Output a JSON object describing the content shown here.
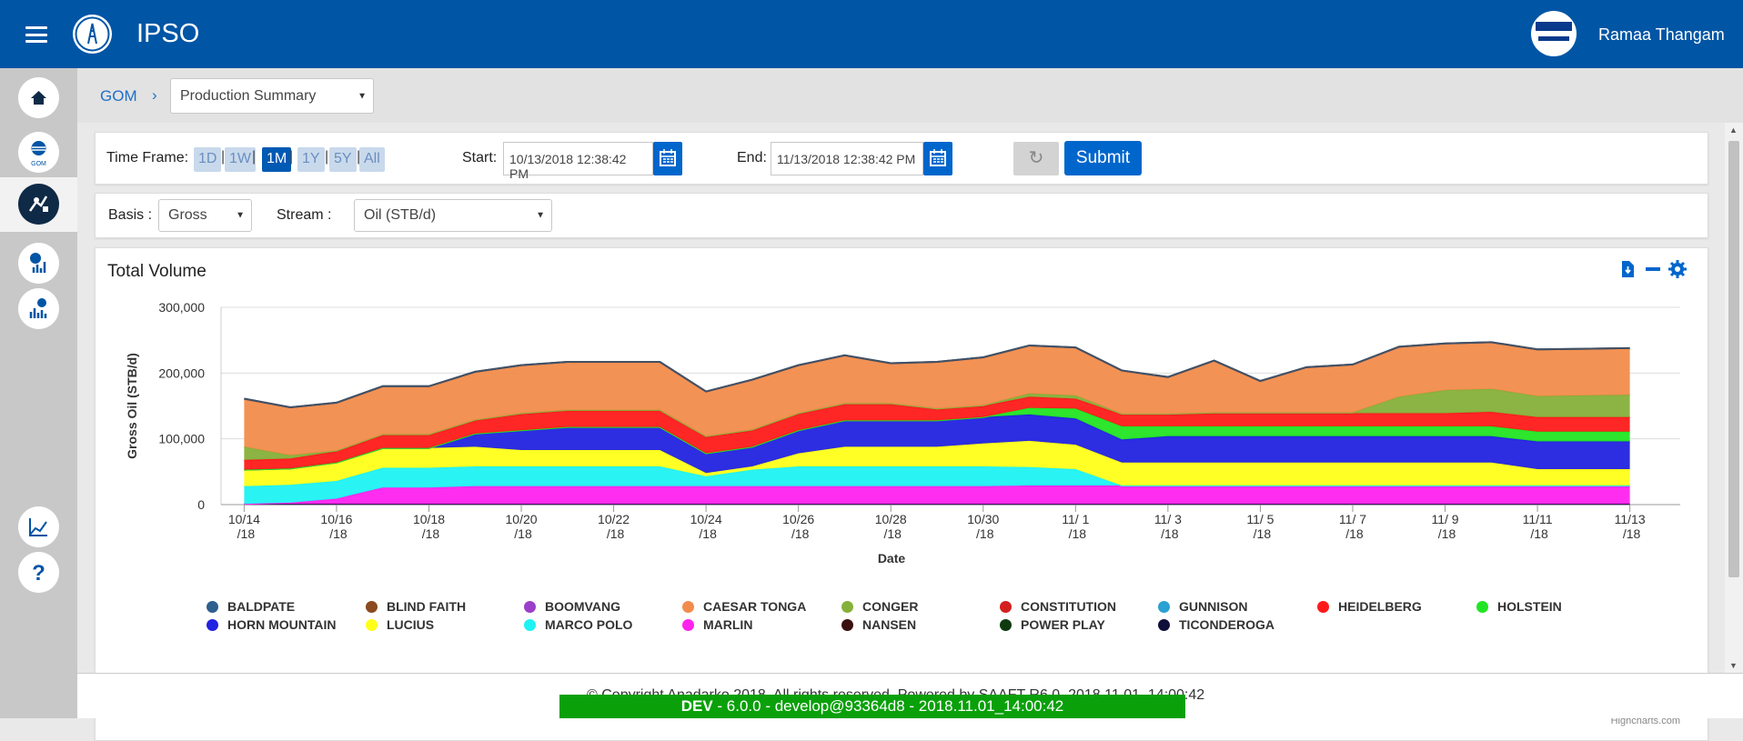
{
  "header": {
    "app_title": "IPSO",
    "user_name": "Ramaa Thangam"
  },
  "sidebar": {
    "items": [
      {
        "name": "home-icon"
      },
      {
        "name": "gom-icon",
        "label": "GOM"
      },
      {
        "name": "production-icon"
      },
      {
        "name": "analytics-icon"
      },
      {
        "name": "reports-icon"
      },
      {
        "name": "trend-icon"
      },
      {
        "name": "help-icon"
      }
    ]
  },
  "breadcrumb": {
    "root": "GOM",
    "separator": "›",
    "page_select": "Production Summary"
  },
  "filters": {
    "timeframe_label": "Time Frame:",
    "timeframes": [
      "1D",
      "1W",
      "1M",
      "1Y",
      "5Y",
      "All"
    ],
    "timeframe_active": "1M",
    "start_label": "Start:",
    "start_value": "10/13/2018 12:38:42 PM",
    "end_label": "End:",
    "end_value": "11/13/2018 12:38:42 PM",
    "submit_label": "Submit"
  },
  "options": {
    "basis_label": "Basis :",
    "basis_value": "Gross",
    "stream_label": "Stream :",
    "stream_value": "Oil (STB/d)"
  },
  "chart_panel": {
    "title": "Total Volume",
    "credits": "Highcharts.com"
  },
  "chart_data": {
    "type": "area",
    "stacked": true,
    "xlabel": "Date",
    "ylabel": "Gross Oil (STB/d)",
    "ylim": [
      0,
      300000
    ],
    "yticks": [
      "0",
      "100,000",
      "200,000",
      "300,000"
    ],
    "xticks": [
      [
        "10/14",
        "/18"
      ],
      [
        "10/16",
        "/18"
      ],
      [
        "10/18",
        "/18"
      ],
      [
        "10/20",
        "/18"
      ],
      [
        "10/22",
        "/18"
      ],
      [
        "10/24",
        "/18"
      ],
      [
        "10/26",
        "/18"
      ],
      [
        "10/28",
        "/18"
      ],
      [
        "10/30",
        "/18"
      ],
      [
        "11/ 1",
        "/18"
      ],
      [
        "11/ 3",
        "/18"
      ],
      [
        "11/ 5",
        "/18"
      ],
      [
        "11/ 7",
        "/18"
      ],
      [
        "11/ 9",
        "/18"
      ],
      [
        "11/11",
        "/18"
      ],
      [
        "11/13",
        "/18"
      ]
    ],
    "x": [
      "2018-10-14",
      "2018-10-15",
      "2018-10-16",
      "2018-10-17",
      "2018-10-18",
      "2018-10-19",
      "2018-10-20",
      "2018-10-21",
      "2018-10-22",
      "2018-10-23",
      "2018-10-24",
      "2018-10-25",
      "2018-10-26",
      "2018-10-27",
      "2018-10-28",
      "2018-10-29",
      "2018-10-30",
      "2018-10-31",
      "2018-11-01",
      "2018-11-02",
      "2018-11-03",
      "2018-11-04",
      "2018-11-05",
      "2018-11-06",
      "2018-11-07",
      "2018-11-08",
      "2018-11-09",
      "2018-11-10",
      "2018-11-11",
      "2018-11-12",
      "2018-11-13"
    ],
    "grid": true,
    "legend_position": "bottom",
    "series": [
      {
        "name": "BALDPATE",
        "color": "#2f5f8f",
        "values": [
          1000,
          1000,
          1000,
          1000,
          1000,
          1000,
          1000,
          1000,
          1000,
          1000,
          1000,
          1000,
          1000,
          1000,
          1000,
          1000,
          1000,
          1000,
          1000,
          1000,
          1000,
          1000,
          1000,
          1000,
          1000,
          1000,
          1000,
          1000,
          1000,
          1000,
          1000
        ]
      },
      {
        "name": "BLIND FAITH",
        "color": "#8b4a1f",
        "values": [
          0,
          0,
          0,
          0,
          0,
          0,
          0,
          0,
          0,
          0,
          0,
          0,
          0,
          0,
          0,
          0,
          0,
          0,
          0,
          0,
          0,
          0,
          0,
          0,
          0,
          0,
          0,
          0,
          0,
          0,
          0
        ]
      },
      {
        "name": "BOOMVANG",
        "color": "#9a3fc9",
        "values": [
          0,
          0,
          0,
          0,
          0,
          0,
          0,
          0,
          0,
          0,
          0,
          0,
          0,
          0,
          0,
          0,
          0,
          0,
          0,
          0,
          0,
          0,
          0,
          0,
          0,
          0,
          0,
          0,
          0,
          0,
          0
        ]
      },
      {
        "name": "CAESAR TONGA",
        "color": "#f28c4c",
        "values": [
          72000,
          72000,
          72000,
          72000,
          72000,
          72000,
          72000,
          72000,
          72000,
          72000,
          67000,
          75000,
          72000,
          72000,
          60000,
          70000,
          72000,
          72000,
          72000,
          65000,
          55000,
          78000,
          47000,
          68000,
          72000,
          75000,
          70000,
          70000,
          70000,
          70000,
          70000
        ]
      },
      {
        "name": "CONGER",
        "color": "#86b03a",
        "values": [
          20000,
          5000,
          1000,
          1000,
          1000,
          1000,
          1000,
          1000,
          1000,
          1000,
          1000,
          1000,
          1000,
          1000,
          1000,
          1000,
          1000,
          5000,
          5000,
          1000,
          1000,
          1000,
          1000,
          1000,
          1000,
          25000,
          35000,
          35000,
          32000,
          33000,
          34000
        ]
      },
      {
        "name": "CONSTITUTION",
        "color": "#d41f1f",
        "values": [
          0,
          0,
          0,
          0,
          0,
          0,
          0,
          0,
          0,
          0,
          0,
          0,
          0,
          0,
          0,
          0,
          0,
          0,
          0,
          0,
          0,
          0,
          0,
          0,
          0,
          0,
          0,
          0,
          0,
          0,
          0
        ]
      },
      {
        "name": "GUNNISON",
        "color": "#2aa1d3",
        "values": [
          0,
          0,
          0,
          0,
          0,
          0,
          0,
          0,
          0,
          0,
          0,
          0,
          0,
          0,
          0,
          0,
          0,
          0,
          0,
          0,
          0,
          0,
          0,
          0,
          0,
          0,
          0,
          0,
          0,
          0,
          0
        ]
      },
      {
        "name": "HEIDELBERG",
        "color": "#ff1a1a",
        "values": [
          15000,
          15000,
          17000,
          20000,
          20000,
          20000,
          25000,
          25000,
          25000,
          25000,
          25000,
          25000,
          25000,
          25000,
          25000,
          17000,
          17000,
          17000,
          15000,
          18000,
          18000,
          20000,
          20000,
          20000,
          20000,
          20000,
          20000,
          22000,
          22000,
          22000,
          22000
        ]
      },
      {
        "name": "HOLSTEIN",
        "color": "#22e522",
        "values": [
          0,
          0,
          0,
          0,
          0,
          0,
          0,
          0,
          0,
          0,
          0,
          0,
          0,
          0,
          0,
          0,
          0,
          10000,
          15000,
          20000,
          15000,
          15000,
          15000,
          15000,
          15000,
          15000,
          15000,
          15000,
          15000,
          15000,
          15000
        ]
      },
      {
        "name": "HORN MOUNTAIN",
        "color": "#2222e0",
        "values": [
          0,
          0,
          0,
          0,
          0,
          20000,
          30000,
          35000,
          35000,
          35000,
          30000,
          30000,
          35000,
          40000,
          40000,
          40000,
          40000,
          40000,
          40000,
          35000,
          40000,
          40000,
          40000,
          40000,
          40000,
          40000,
          40000,
          40000,
          42000,
          42000,
          42000
        ]
      },
      {
        "name": "LUCIUS",
        "color": "#ffff1a",
        "values": [
          25000,
          25000,
          28000,
          30000,
          30000,
          30000,
          25000,
          25000,
          25000,
          25000,
          5000,
          5000,
          20000,
          30000,
          30000,
          30000,
          35000,
          40000,
          37000,
          35000,
          35000,
          35000,
          35000,
          35000,
          35000,
          35000,
          35000,
          35000,
          25000,
          25000,
          25000
        ]
      },
      {
        "name": "MARCO POLO",
        "color": "#1ff2f2",
        "values": [
          27000,
          27000,
          27000,
          30000,
          30000,
          30000,
          30000,
          30000,
          30000,
          30000,
          15000,
          25000,
          30000,
          30000,
          30000,
          30000,
          30000,
          28000,
          25000,
          0,
          0,
          0,
          0,
          0,
          0,
          0,
          0,
          0,
          0,
          0,
          0
        ]
      },
      {
        "name": "MARLIN",
        "color": "#ff22ee",
        "values": [
          0,
          2000,
          8000,
          25000,
          25000,
          27000,
          27000,
          27000,
          27000,
          27000,
          27000,
          27000,
          27000,
          27000,
          27000,
          27000,
          27000,
          28000,
          28000,
          28000,
          28000,
          28000,
          28000,
          28000,
          28000,
          28000,
          28000,
          28000,
          28000,
          28000,
          28000
        ]
      },
      {
        "name": "NANSEN",
        "color": "#3a0f0f",
        "values": [
          0,
          0,
          0,
          0,
          0,
          0,
          0,
          0,
          0,
          0,
          0,
          0,
          0,
          0,
          0,
          0,
          0,
          0,
          0,
          0,
          0,
          0,
          0,
          0,
          0,
          0,
          0,
          0,
          0,
          0,
          0
        ]
      },
      {
        "name": "POWER PLAY",
        "color": "#0f3a0f",
        "values": [
          0,
          0,
          0,
          0,
          0,
          0,
          0,
          0,
          0,
          0,
          0,
          0,
          0,
          0,
          0,
          0,
          0,
          0,
          0,
          0,
          0,
          0,
          0,
          0,
          0,
          0,
          0,
          0,
          0,
          0,
          0
        ]
      },
      {
        "name": "TICONDEROGA",
        "color": "#0f0f3a",
        "values": [
          1000,
          1000,
          1000,
          1000,
          1000,
          1000,
          1000,
          1000,
          1000,
          1000,
          1000,
          1000,
          1000,
          1000,
          1000,
          1000,
          1000,
          1000,
          1000,
          1000,
          1000,
          1000,
          1000,
          1000,
          1000,
          1000,
          1000,
          1000,
          1000,
          1000,
          1000
        ]
      }
    ]
  },
  "footer": {
    "copyright": "© Copyright Anadarko 2018. All rights reserved. Powered by SAAFT R6.0_2018.11.01_14:00:42",
    "env_prefix": "DEV",
    "env_text": " - 6.0.0 - develop@93364d8 - 2018.11.01_14:00:42"
  }
}
